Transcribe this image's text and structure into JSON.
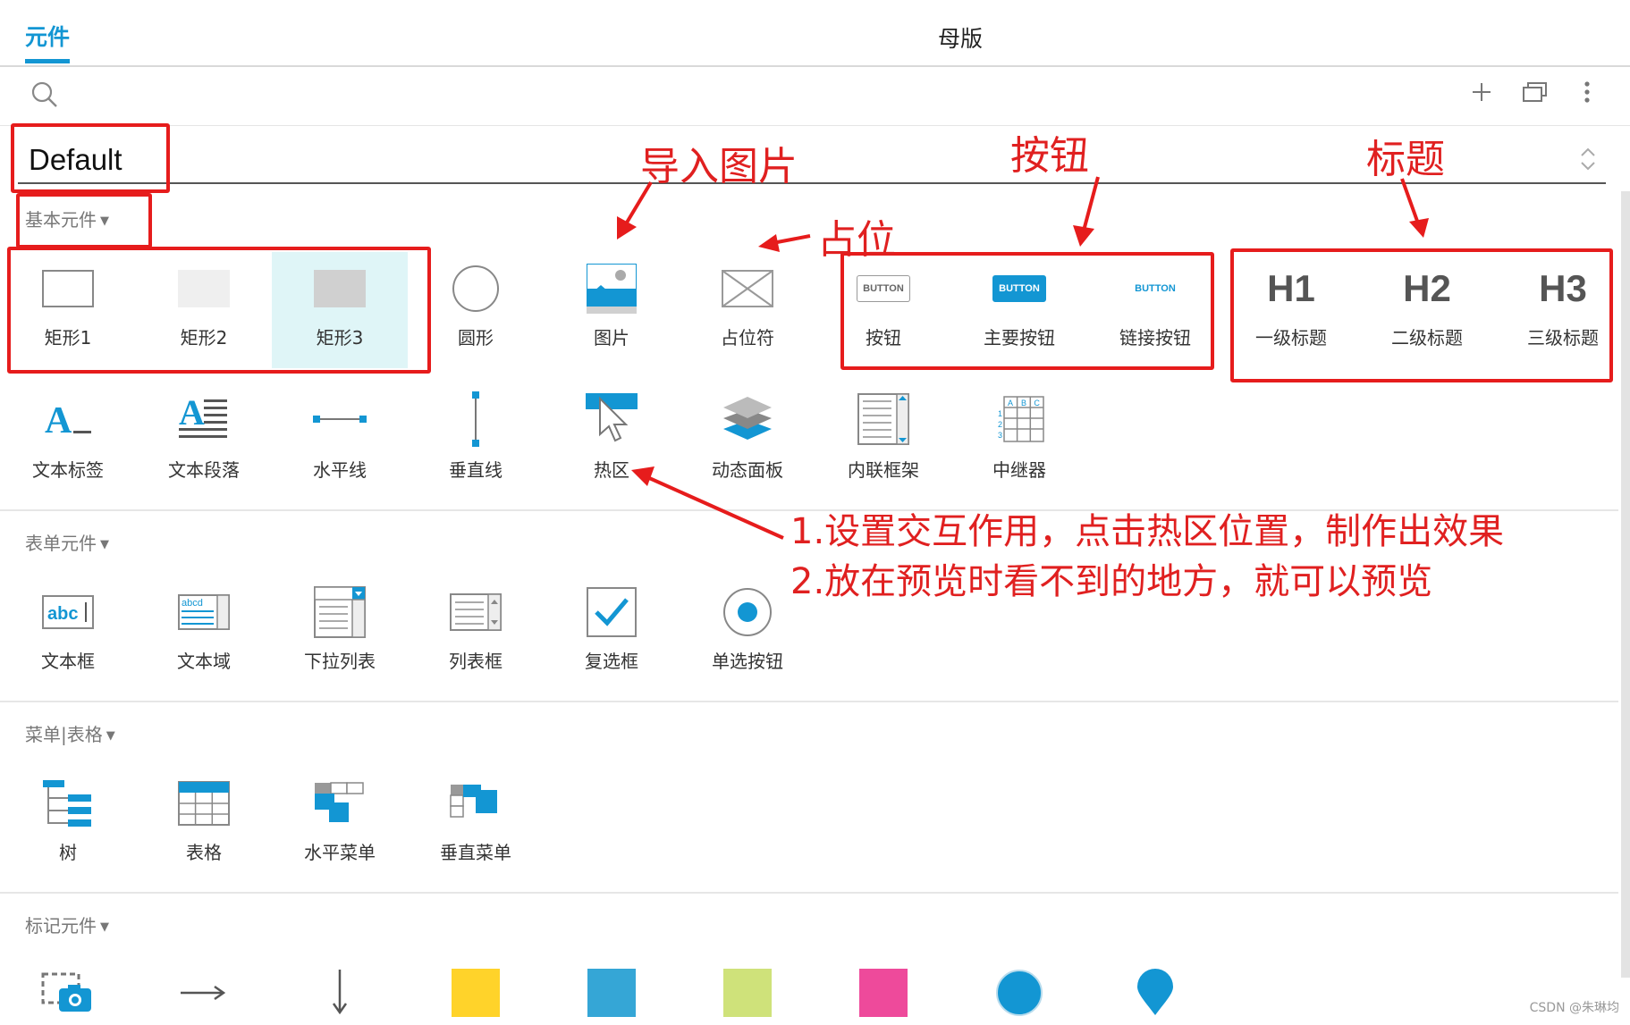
{
  "tabs": {
    "active": "元件",
    "master": "母版"
  },
  "library": {
    "name": "Default"
  },
  "sections": {
    "basic": "基本元件",
    "form": "表单元件",
    "menu": "菜单|表格",
    "markup": "标记元件"
  },
  "basic_row1": [
    "矩形1",
    "矩形2",
    "矩形3",
    "圆形",
    "图片",
    "占位符",
    "按钮",
    "主要按钮",
    "链接按钮",
    "一级标题",
    "二级标题",
    "三级标题"
  ],
  "basic_row2": [
    "文本标签",
    "文本段落",
    "水平线",
    "垂直线",
    "热区",
    "动态面板",
    "内联框架",
    "中继器"
  ],
  "form_items": [
    "文本框",
    "文本域",
    "下拉列表",
    "列表框",
    "复选框",
    "单选按钮"
  ],
  "menu_items": [
    "树",
    "表格",
    "水平菜单",
    "垂直菜单"
  ],
  "icon_text": {
    "button": "BUTTON",
    "h1": "H1",
    "h2": "H2",
    "h3": "H3",
    "textbox": "abc",
    "textarea": "abcd"
  },
  "markup_colors": [
    "#ffd32a",
    "#35a6d6",
    "#cfe27a",
    "#ee4a9b",
    "#1396d3",
    "#1396d3"
  ],
  "annotations": {
    "import_image": "导入图片",
    "placeholder": "占位",
    "button": "按钮",
    "heading": "标题",
    "note1": "1.设置交互作用，点击热区位置，制作出效果",
    "note2": "2.放在预览时看不到的地方，就可以预览"
  },
  "colors": {
    "accent": "#1396d3",
    "annotation": "#e61c1c",
    "selected_bg": "#dff5f7"
  },
  "watermark": "CSDN @朱琳均"
}
